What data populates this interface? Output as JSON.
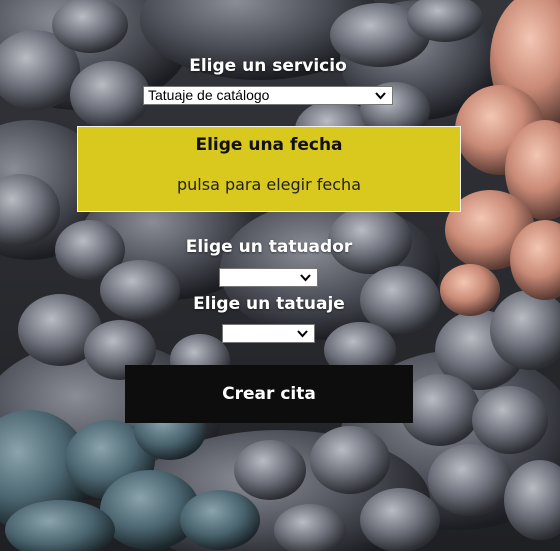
{
  "service": {
    "heading": "Elige un servicio",
    "selected": "Tatuaje de catálogo"
  },
  "date": {
    "heading": "Elige una fecha",
    "prompt": "pulsa para elegir fecha",
    "color": "#d9c81e"
  },
  "artist": {
    "heading": "Elige un tatuador",
    "selected": ""
  },
  "tattoo": {
    "heading": "Elige un tatuaje",
    "selected": ""
  },
  "submit": {
    "label": "Crear cita",
    "color": "#0d0d0d"
  },
  "background": {
    "description_icon": "smoke-clouds-background"
  }
}
